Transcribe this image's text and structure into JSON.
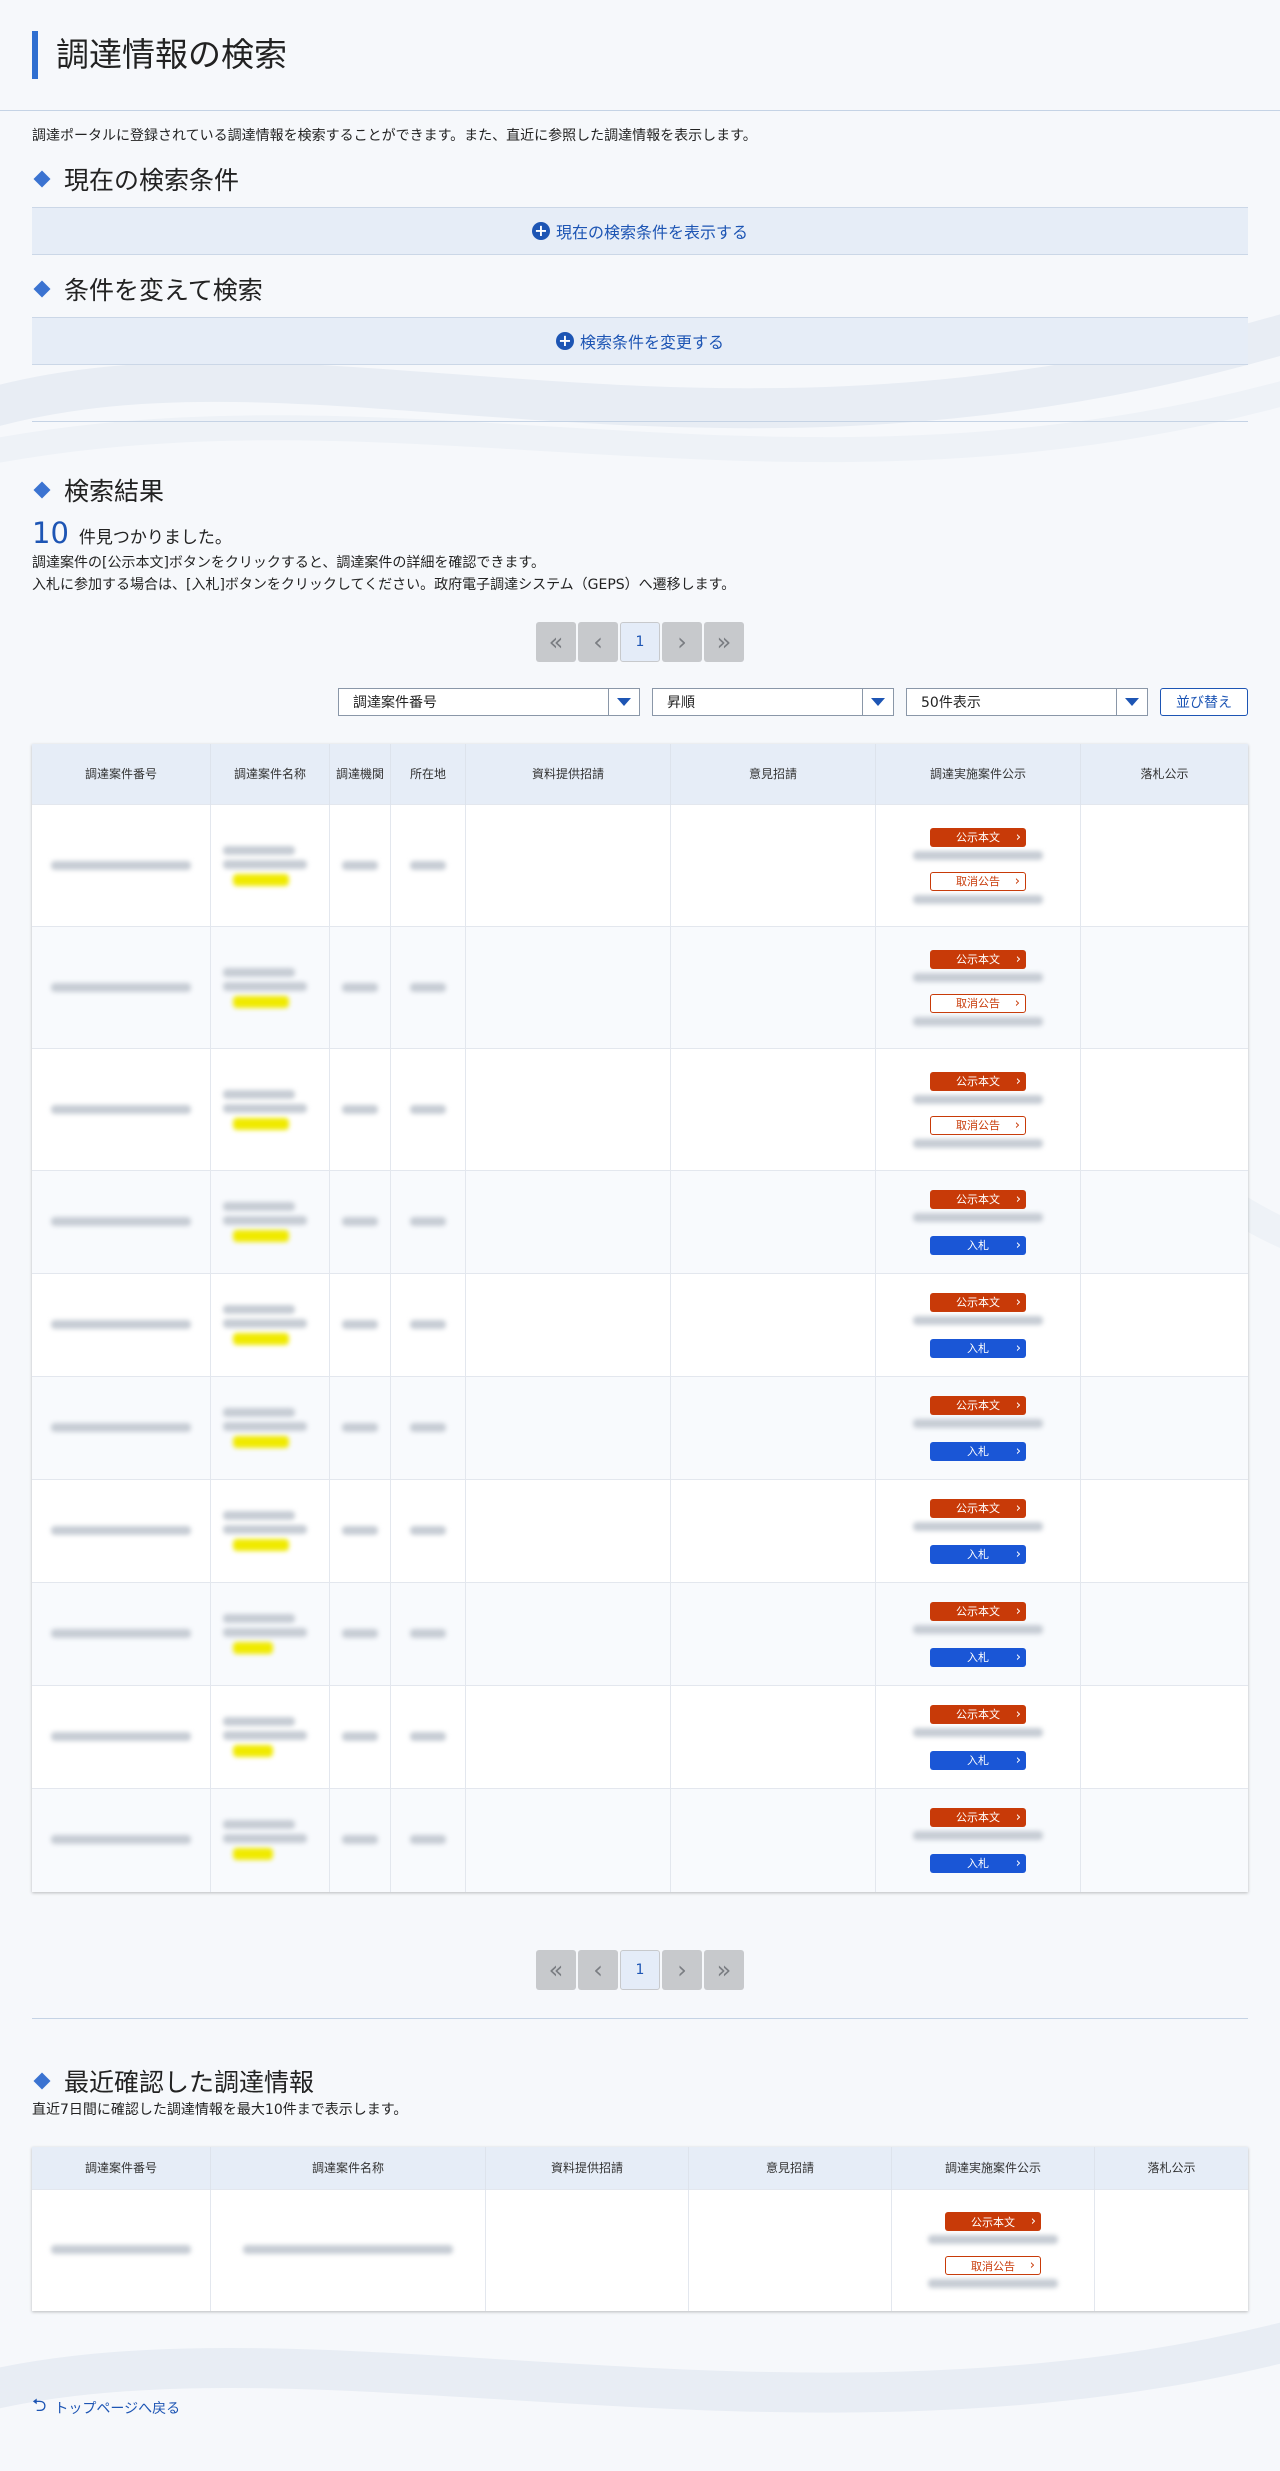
{
  "page_title": "調達情報の検索",
  "intro": "調達ポータルに登録されている調達情報を検索することができます。また、直近に参照した調達情報を表示します。",
  "current_conditions": {
    "heading": "現在の検索条件",
    "toggle_label": "現在の検索条件を表示する"
  },
  "change_conditions": {
    "heading": "条件を変えて検索",
    "toggle_label": "検索条件を変更する"
  },
  "results": {
    "heading": "検索結果",
    "count": "10",
    "count_suffix": "件見つかりました。",
    "note1": "調達案件の[公示本文]ボタンをクリックすると、調達案件の詳細を確認できます。",
    "note2": "入札に参加する場合は、[入札]ボタンをクリックしてください。政府電子調達システム（GEPS）へ遷移します。"
  },
  "pager": {
    "first": "«",
    "prev": "‹",
    "current": "1",
    "next": "›",
    "last": "»"
  },
  "sort": {
    "field": "調達案件番号",
    "order": "昇順",
    "per_page": "50件表示",
    "button": "並び替え"
  },
  "table": {
    "headers": [
      "調達案件番号",
      "調達案件名称",
      "調達機関",
      "所在地",
      "資料提供招請",
      "意見招請",
      "調達実施案件公示",
      "落札公示"
    ],
    "buttons": {
      "kokuji": "公示本文",
      "torikeshi": "取消公告",
      "nyusatsu": "入札"
    },
    "rows": [
      {
        "type": "torikeshi"
      },
      {
        "type": "torikeshi"
      },
      {
        "type": "torikeshi"
      },
      {
        "type": "nyusatsu"
      },
      {
        "type": "nyusatsu"
      },
      {
        "type": "nyusatsu"
      },
      {
        "type": "nyusatsu"
      },
      {
        "type": "nyusatsu"
      },
      {
        "type": "nyusatsu"
      },
      {
        "type": "nyusatsu"
      }
    ]
  },
  "recent": {
    "heading": "最近確認した調達情報",
    "note": "直近7日間に確認した調達情報を最大10件まで表示します。",
    "headers": [
      "調達案件番号",
      "調達案件名称",
      "資料提供招請",
      "意見招請",
      "調達実施案件公示",
      "落札公示"
    ],
    "buttons": {
      "kokuji": "公示本文",
      "torikeshi": "取消公告"
    }
  },
  "back_link": "トップページへ戻る",
  "colors": {
    "accent": "#1d55b4",
    "kokuji": "#c83a08",
    "nyusatsu": "#1a56d6"
  }
}
